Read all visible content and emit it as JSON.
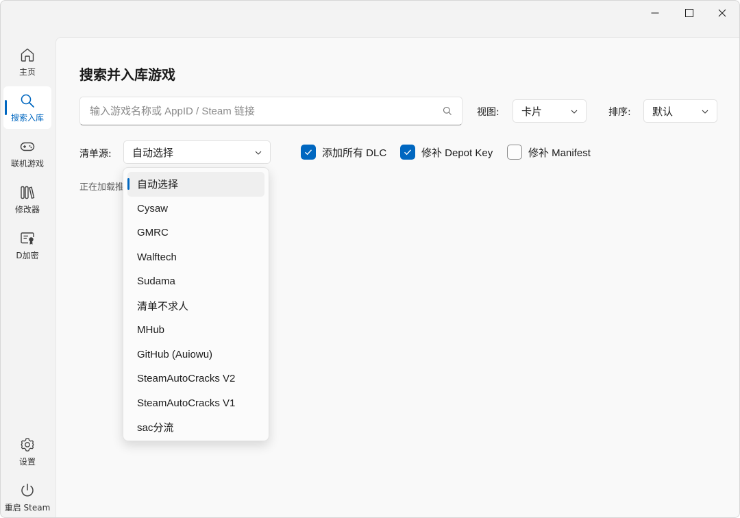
{
  "window": {
    "controls": {
      "minimize": "minimize-icon",
      "maximize": "maximize-icon",
      "close": "close-icon"
    }
  },
  "sidebar": {
    "items": [
      {
        "label": "主页",
        "icon": "home-icon",
        "active": false
      },
      {
        "label": "搜索入库",
        "icon": "search-icon",
        "active": true
      },
      {
        "label": "联机游戏",
        "icon": "gamepad-icon",
        "active": false
      },
      {
        "label": "修改器",
        "icon": "library-icon",
        "active": false
      },
      {
        "label": "D加密",
        "icon": "certificate-icon",
        "active": false
      }
    ],
    "bottom": [
      {
        "label": "设置",
        "icon": "gear-icon"
      },
      {
        "label": "重启 Steam",
        "icon": "power-icon"
      }
    ]
  },
  "main": {
    "title": "搜索并入库游戏",
    "search": {
      "placeholder": "输入游戏名称或 AppID / Steam 链接",
      "value": ""
    },
    "view": {
      "label": "视图:",
      "value": "卡片"
    },
    "sort": {
      "label": "排序:",
      "value": "默认"
    },
    "source": {
      "label": "清单源:",
      "value": "自动选择"
    },
    "options": [
      {
        "label": "添加所有 DLC",
        "checked": true
      },
      {
        "label": "修补 Depot Key",
        "checked": true
      },
      {
        "label": "修补 Manifest",
        "checked": false
      }
    ],
    "status_text": "正在加载推"
  },
  "source_dropdown": {
    "selected_index": 0,
    "items": [
      "自动选择",
      "Cysaw",
      "GMRC",
      "Walftech",
      "Sudama",
      "清单不求人",
      "MHub",
      "GitHub (Auiowu)",
      "SteamAutoCracks V2",
      "SteamAutoCracks V1",
      "sac分流"
    ]
  },
  "colors": {
    "accent": "#0067c0",
    "window_bg": "#f3f3f3",
    "content_bg": "#f9f9f9"
  }
}
